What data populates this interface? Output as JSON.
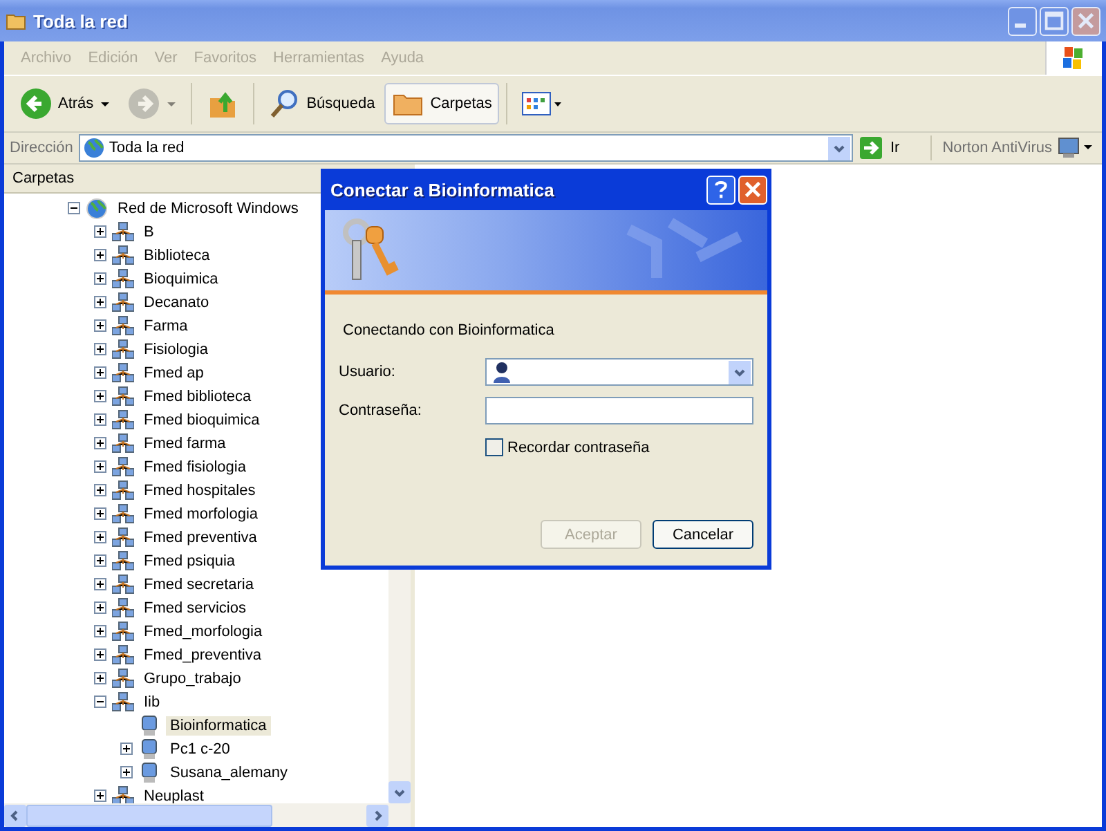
{
  "window": {
    "title": "Toda la red"
  },
  "menu": [
    {
      "label": "Archivo"
    },
    {
      "label": "Edición"
    },
    {
      "label": "Ver"
    },
    {
      "label": "Favoritos"
    },
    {
      "label": "Herramientas"
    },
    {
      "label": "Ayuda"
    }
  ],
  "toolbar": [
    {
      "kind": "back",
      "label": "Atrás",
      "selected": false,
      "disabled": false
    },
    {
      "kind": "forward",
      "selected": false,
      "disabled": true
    },
    {
      "kind": "up",
      "selected": false,
      "disabled": false
    },
    {
      "kind": "search",
      "label": "Búsqueda",
      "selected": false,
      "disabled": false
    },
    {
      "kind": "folders",
      "label": "Carpetas",
      "selected": true,
      "disabled": false
    },
    {
      "kind": "views",
      "selected": false,
      "disabled": false
    }
  ],
  "address": {
    "label": "Dirección",
    "value": "Toda la red",
    "go": "Ir",
    "norton": "Norton AntiVirus"
  },
  "folders_pane": {
    "title": "Carpetas",
    "tree": [
      {
        "label": "Red de Microsoft Windows",
        "kind": "network",
        "expandable": true,
        "expanded": true,
        "selected": false,
        "children": [
          {
            "label": "B",
            "kind": "workgroup",
            "expandable": true,
            "expanded": false,
            "selected": false
          },
          {
            "label": "Biblioteca",
            "kind": "workgroup",
            "expandable": true,
            "expanded": false,
            "selected": false
          },
          {
            "label": "Bioquimica",
            "kind": "workgroup",
            "expandable": true,
            "expanded": false,
            "selected": false
          },
          {
            "label": "Decanato",
            "kind": "workgroup",
            "expandable": true,
            "expanded": false,
            "selected": false
          },
          {
            "label": "Farma",
            "kind": "workgroup",
            "expandable": true,
            "expanded": false,
            "selected": false
          },
          {
            "label": "Fisiologia",
            "kind": "workgroup",
            "expandable": true,
            "expanded": false,
            "selected": false
          },
          {
            "label": "Fmed ap",
            "kind": "workgroup",
            "expandable": true,
            "expanded": false,
            "selected": false
          },
          {
            "label": "Fmed biblioteca",
            "kind": "workgroup",
            "expandable": true,
            "expanded": false,
            "selected": false
          },
          {
            "label": "Fmed bioquimica",
            "kind": "workgroup",
            "expandable": true,
            "expanded": false,
            "selected": false
          },
          {
            "label": "Fmed farma",
            "kind": "workgroup",
            "expandable": true,
            "expanded": false,
            "selected": false
          },
          {
            "label": "Fmed fisiologia",
            "kind": "workgroup",
            "expandable": true,
            "expanded": false,
            "selected": false
          },
          {
            "label": "Fmed hospitales",
            "kind": "workgroup",
            "expandable": true,
            "expanded": false,
            "selected": false
          },
          {
            "label": "Fmed morfologia",
            "kind": "workgroup",
            "expandable": true,
            "expanded": false,
            "selected": false
          },
          {
            "label": "Fmed preventiva",
            "kind": "workgroup",
            "expandable": true,
            "expanded": false,
            "selected": false
          },
          {
            "label": "Fmed psiquia",
            "kind": "workgroup",
            "expandable": true,
            "expanded": false,
            "selected": false
          },
          {
            "label": "Fmed secretaria",
            "kind": "workgroup",
            "expandable": true,
            "expanded": false,
            "selected": false
          },
          {
            "label": "Fmed servicios",
            "kind": "workgroup",
            "expandable": true,
            "expanded": false,
            "selected": false
          },
          {
            "label": "Fmed_morfologia",
            "kind": "workgroup",
            "expandable": true,
            "expanded": false,
            "selected": false
          },
          {
            "label": "Fmed_preventiva",
            "kind": "workgroup",
            "expandable": true,
            "expanded": false,
            "selected": false
          },
          {
            "label": "Grupo_trabajo",
            "kind": "workgroup",
            "expandable": true,
            "expanded": false,
            "selected": false
          },
          {
            "label": "Iib",
            "kind": "workgroup",
            "expandable": true,
            "expanded": true,
            "selected": false,
            "children": [
              {
                "label": "Bioinformatica",
                "kind": "computer",
                "expandable": false,
                "selected": true
              },
              {
                "label": "Pc1 c-20",
                "kind": "computer",
                "expandable": true,
                "expanded": false,
                "selected": false
              },
              {
                "label": "Susana_alemany",
                "kind": "computer",
                "expandable": true,
                "expanded": false,
                "selected": false
              }
            ]
          },
          {
            "label": "Neuplast",
            "kind": "workgroup",
            "expandable": true,
            "expanded": false,
            "selected": false
          }
        ]
      }
    ]
  },
  "dialog": {
    "title": "Conectar a Bioinformatica",
    "message": "Conectando con Bioinformatica",
    "user_label": "Usuario:",
    "password_label": "Contraseña:",
    "remember": {
      "label": "Recordar contraseña",
      "checked": false
    },
    "buttons": [
      {
        "label": "Aceptar",
        "disabled": true
      },
      {
        "label": "Cancelar",
        "disabled": false
      }
    ]
  }
}
